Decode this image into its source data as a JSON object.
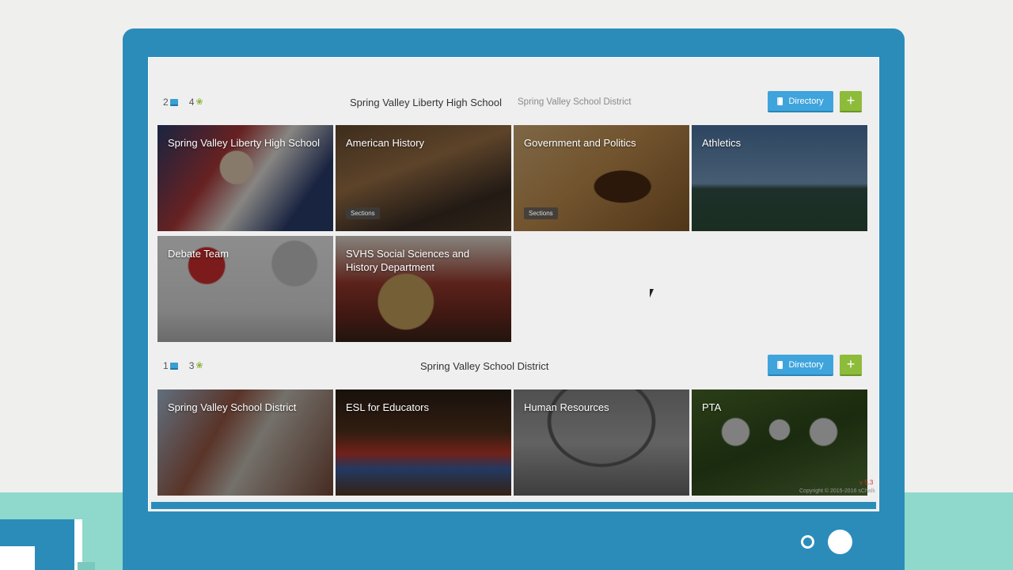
{
  "sections": [
    {
      "counts": {
        "books": "2",
        "paws": "4"
      },
      "title": "Spring Valley Liberty High School",
      "subtitle": "Spring Valley School District",
      "directory_label": "Directory",
      "add_label": "+",
      "tiles": [
        {
          "name": "Spring Valley Liberty High School"
        },
        {
          "name": "American History",
          "badge": "Sections"
        },
        {
          "name": "Government and Politics",
          "badge": "Sections"
        },
        {
          "name": "Athletics"
        },
        {
          "name": "Debate Team"
        },
        {
          "name": "SVHS Social Sciences and History Department"
        }
      ]
    },
    {
      "counts": {
        "books": "1",
        "paws": "3"
      },
      "title": "Spring Valley School District",
      "directory_label": "Directory",
      "add_label": "+",
      "tiles": [
        {
          "name": "Spring Valley School District"
        },
        {
          "name": "ESL for Educators"
        },
        {
          "name": "Human Resources"
        },
        {
          "name": "PTA"
        }
      ]
    }
  ],
  "footer": {
    "version": "v 5.3",
    "copyright": "Copyright © 2015-2016 sChalk"
  },
  "colors": {
    "device": "#2b8cba",
    "directory_button": "#3fa4dc",
    "add_button": "#8dbb3a"
  }
}
